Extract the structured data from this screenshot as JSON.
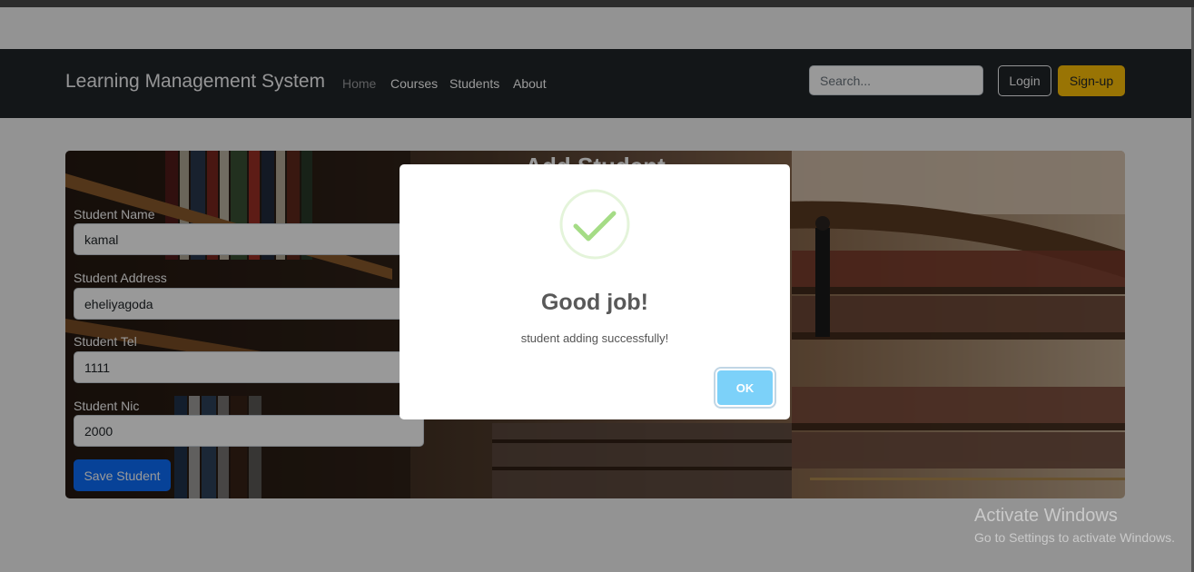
{
  "navbar": {
    "brand": "Learning Management System",
    "links": [
      {
        "label": "Home",
        "active": false
      },
      {
        "label": "Courses"
      },
      {
        "label": "Students"
      },
      {
        "label": "About"
      }
    ],
    "search_placeholder": "Search...",
    "login_label": "Login",
    "signup_label": "Sign-up"
  },
  "form": {
    "title": "Add Student",
    "fields": [
      {
        "label": "Student Name",
        "value": "kamal"
      },
      {
        "label": "Student Address",
        "value": "eheliyagoda"
      },
      {
        "label": "Student Tel",
        "value": "1111"
      },
      {
        "label": "Student Nic",
        "value": "2000"
      }
    ],
    "save_label": "Save Student"
  },
  "dialog": {
    "icon": "success-check-icon",
    "title": "Good job!",
    "text": "student adding successfully!",
    "ok_label": "OK"
  },
  "watermark": {
    "title": "Activate Windows",
    "subtitle": "Go to Settings to activate Windows."
  },
  "colors": {
    "navbar_bg": "#212529",
    "signup_bg": "#ffc107",
    "save_bg": "#0d6efd",
    "ok_bg": "#7cd1f9",
    "success_check": "#a5dc86"
  }
}
